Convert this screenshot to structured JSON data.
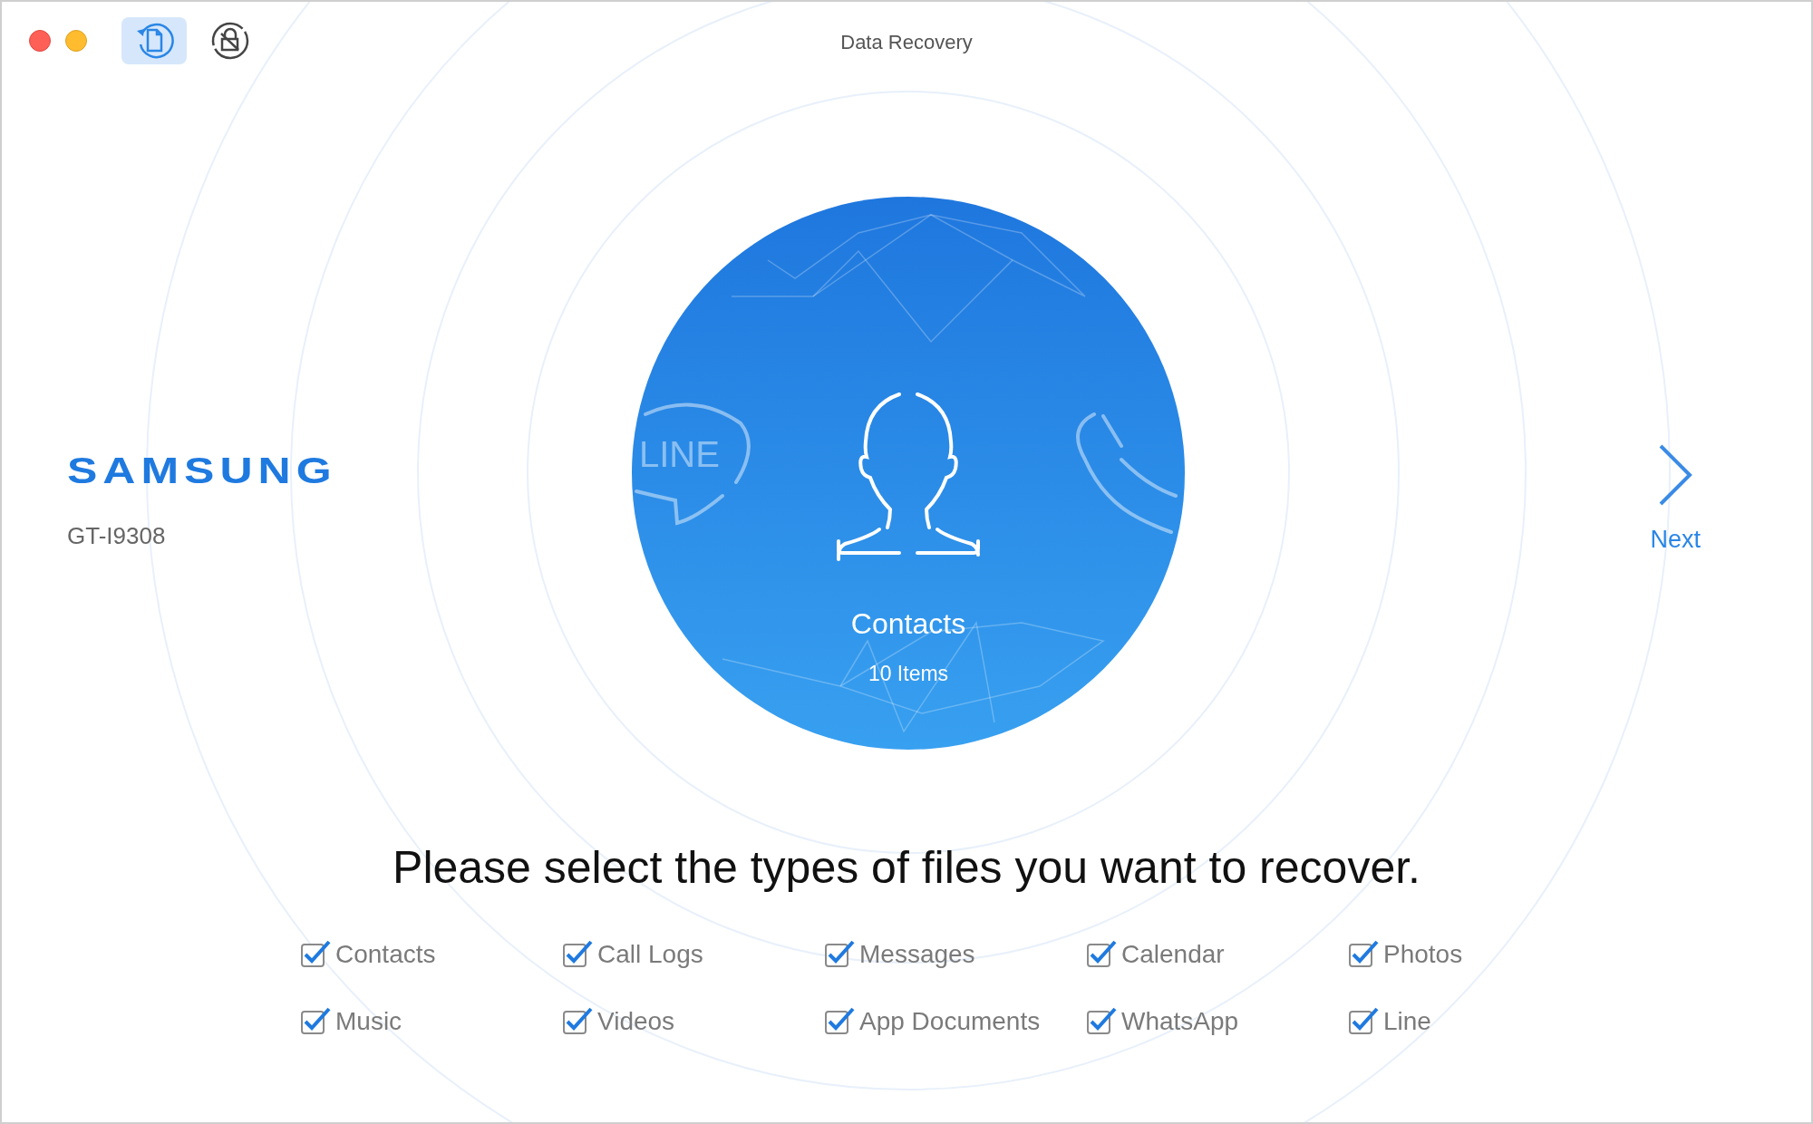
{
  "window": {
    "title": "Data Recovery"
  },
  "toolbar": [
    {
      "kind": "recover",
      "selected": true
    },
    {
      "kind": "unlock",
      "selected": false
    }
  ],
  "device": {
    "brand": "SAMSUNG",
    "model": "GT-I9308"
  },
  "category": {
    "badge_text": "LINE",
    "name": "Contacts",
    "count": "10 Items"
  },
  "next": {
    "label": "Next"
  },
  "prompt": "Please select the types of files you want to recover.",
  "file_types": [
    {
      "label": "Contacts",
      "checked": true
    },
    {
      "label": "Call Logs",
      "checked": true
    },
    {
      "label": "Messages",
      "checked": true
    },
    {
      "label": "Calendar",
      "checked": true
    },
    {
      "label": "Photos",
      "checked": true
    },
    {
      "label": "Music",
      "checked": true
    },
    {
      "label": "Videos",
      "checked": true
    },
    {
      "label": "App Documents",
      "checked": true
    },
    {
      "label": "WhatsApp",
      "checked": true
    },
    {
      "label": "Line",
      "checked": true
    }
  ]
}
